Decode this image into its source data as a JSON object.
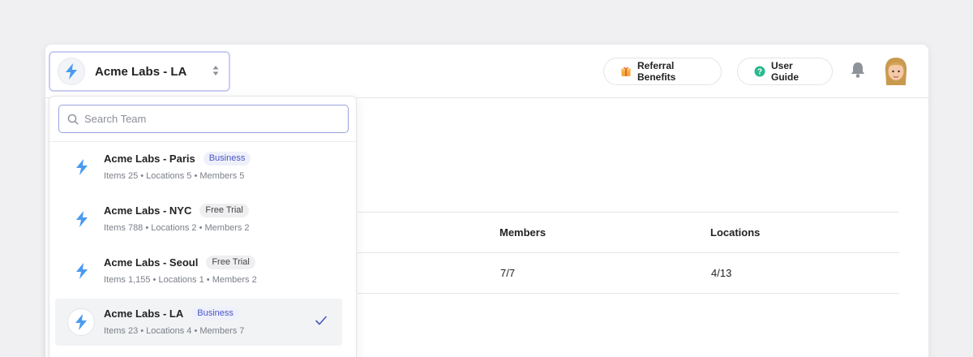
{
  "header": {
    "current_team": "Acme Labs - LA",
    "referral_label": "Referral Benefits",
    "guide_label": "User Guide"
  },
  "table": {
    "headers": [
      "Members",
      "Locations"
    ],
    "row": [
      "7/7",
      "4/13"
    ]
  },
  "dropdown": {
    "search_placeholder": "Search Team",
    "teams": [
      {
        "name": "Acme Labs - Paris",
        "plan": "Business",
        "items": "Items 25",
        "locations": "Locations 5",
        "members": "Members 5",
        "selected": false
      },
      {
        "name": "Acme Labs - NYC",
        "plan": "Free Trial",
        "items": "Items 788",
        "locations": "Locations 2",
        "members": "Members 2",
        "selected": false
      },
      {
        "name": "Acme Labs - Seoul",
        "plan": "Free Trial",
        "items": "Items 1,155",
        "locations": "Locations 1",
        "members": "Members 2",
        "selected": false
      },
      {
        "name": "Acme Labs - LA",
        "plan": "Business",
        "items": "Items 23",
        "locations": "Locations 4",
        "members": "Members 7",
        "selected": true
      }
    ]
  },
  "colors": {
    "bolt": "#4a9af0",
    "business_badge_text": "#4a56c4",
    "focus_border": "#9aa3e0",
    "help_icon": "#2bb88f",
    "gift_icon": "#f2a93b"
  },
  "icons": {
    "team": "bolt-icon",
    "switcher": "chevron-updown-icon",
    "search": "search-icon",
    "referral": "gift-icon",
    "guide": "help-circle-icon",
    "notifications": "bell-icon",
    "selected": "check-icon"
  }
}
